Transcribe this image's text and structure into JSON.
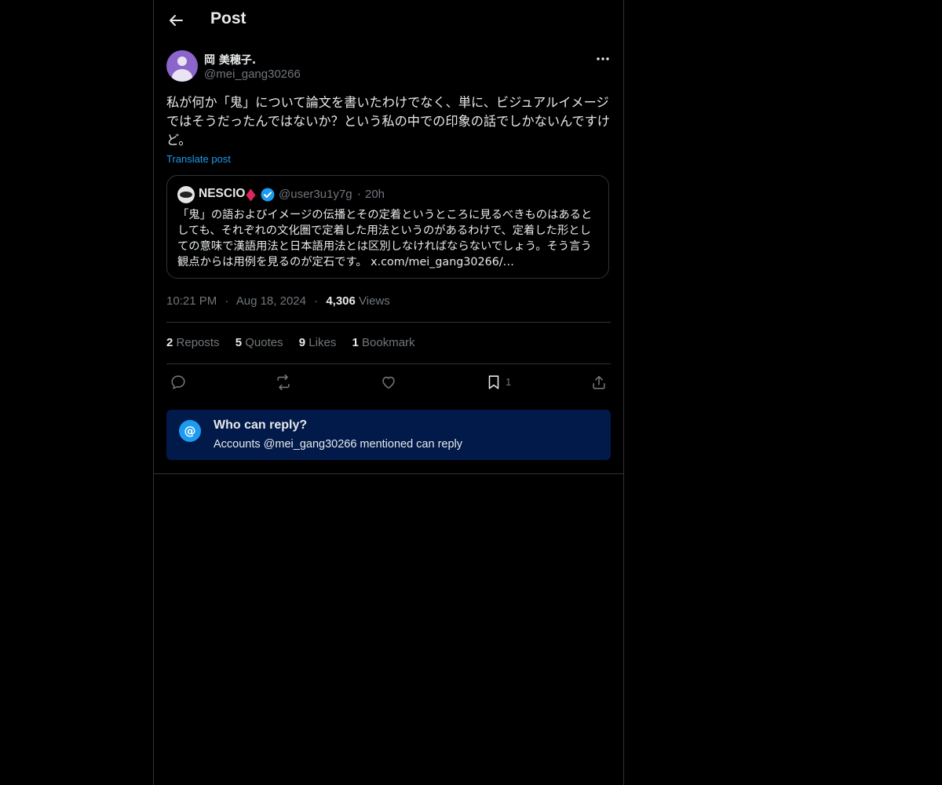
{
  "header": {
    "title": "Post",
    "back_icon": "arrow-left-icon"
  },
  "post": {
    "author": {
      "display_name": "岡 美穂子.",
      "handle": "@mei_gang30266"
    },
    "text": "私が何か「鬼」について論文を書いたわけでなく、単に、ビジュアルイメージではそうだったんではないか？という私の中での印象の話でしかないんですけど。",
    "translate_label": "Translate post",
    "quoted": {
      "display_name": "NESCIO",
      "handle": "@user3u1y7g",
      "separator": "·",
      "time": "20h",
      "text": "「鬼」の語およびイメージの伝播とその定着というところに見るべきものはあるとしても、それぞれの文化圏で定着した用法というのがあるわけで、定着した形としての意味で漢語用法と日本語用法とは区別しなければならないでしょう。そう言う観点からは用例を見るのが定石です。 x.com/mei_gang30266/…"
    },
    "meta": {
      "time": "10:21 PM",
      "date": "Aug 18, 2024",
      "views_count": "4,306",
      "views_label": "Views",
      "sep": "·"
    },
    "stats": {
      "reposts_count": "2",
      "reposts_label": "Reposts",
      "quotes_count": "5",
      "quotes_label": "Quotes",
      "likes_count": "9",
      "likes_label": "Likes",
      "bookmarks_count": "1",
      "bookmarks_label": "Bookmark"
    },
    "actions": {
      "bookmark_count": "1"
    }
  },
  "reply_restriction": {
    "icon": "@",
    "title": "Who can reply?",
    "subtitle": "Accounts @mei_gang30266 mentioned can reply"
  },
  "colors": {
    "accent": "#1d9bf0",
    "background": "#000000",
    "secondary_text": "#71767b",
    "reply_box": "#021a4a"
  }
}
